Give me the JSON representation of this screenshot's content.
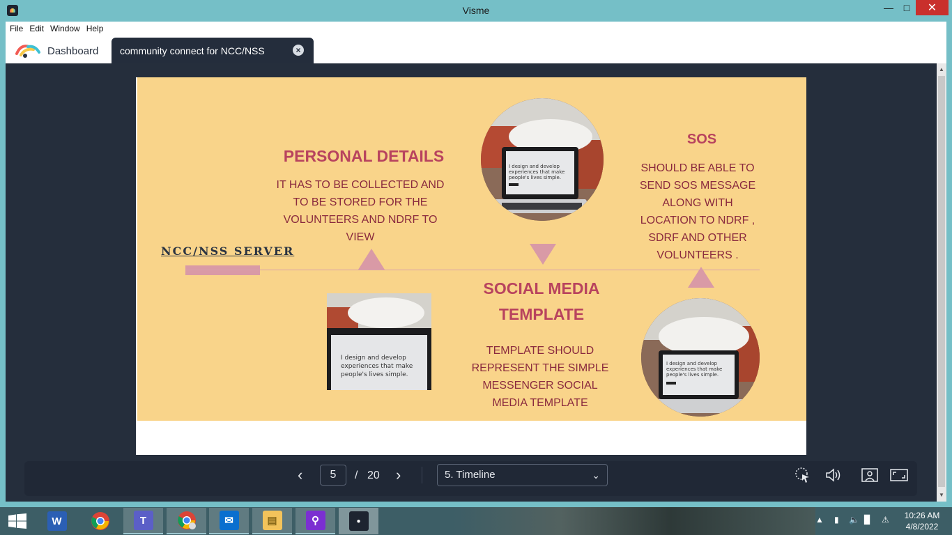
{
  "window": {
    "title": "Visme"
  },
  "menu": [
    "File",
    "Edit",
    "Window",
    "Help"
  ],
  "tabs": {
    "dashboard": "Dashboard",
    "active": "community connect for NCC/NSS"
  },
  "slide": {
    "personal_heading": "PERSONAL DETAILS",
    "personal_body": "IT HAS  TO BE COLLECTED AND TO BE STORED FOR THE VOLUNTEERS AND NDRF TO VIEW",
    "server_label": "NCC/NSS SERVER",
    "social_heading_1": "SOCIAL MEDIA",
    "social_heading_2": "TEMPLATE",
    "social_body": "TEMPLATE SHOULD REPRESENT THE SIMPLE MESSENGER SOCIAL MEDIA TEMPLATE",
    "sos_heading": "SOS",
    "sos_body": "SHOULD BE ABLE TO SEND SOS MESSAGE ALONG WITH LOCATION TO NDRF , SDRF AND OTHER VOLUNTEERS .",
    "photo_caption": "I design and develop experiences that make people's lives simple."
  },
  "controls": {
    "current_page": "5",
    "separator": "/",
    "total_pages": "20",
    "section_select": "5. Timeline"
  },
  "taskbar": {
    "time": "10:26 AM",
    "date": "4/8/2022"
  },
  "colors": {
    "slide_bg": "#f9d48a",
    "heading": "#b8435e",
    "body_text": "#8a2a3e",
    "accent_pink": "#d99aa6",
    "stage_bg": "#252e3c"
  }
}
